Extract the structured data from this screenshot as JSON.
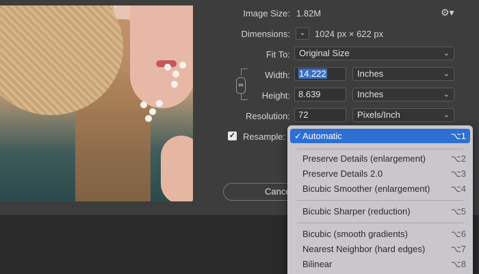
{
  "dialog": {
    "image_size_label": "Image Size:",
    "image_size_value": "1.82M",
    "dimensions_label": "Dimensions:",
    "dimensions_value": "1024 px  ×  622 px",
    "fit_to_label": "Fit To:",
    "fit_to_value": "Original Size",
    "width_label": "Width:",
    "width_value": "14.222",
    "width_unit": "Inches",
    "height_label": "Height:",
    "height_value": "8.639",
    "height_unit": "Inches",
    "resolution_label": "Resolution:",
    "resolution_value": "72",
    "resolution_unit": "Pixels/Inch",
    "resample_label": "Resample:",
    "cancel_label": "Cancel"
  },
  "menu": {
    "items": [
      {
        "label": "Automatic",
        "shortcut": "⌥1",
        "selected": true
      },
      {
        "label": "Preserve Details (enlargement)",
        "shortcut": "⌥2"
      },
      {
        "label": "Preserve Details 2.0",
        "shortcut": "⌥3"
      },
      {
        "label": "Bicubic Smoother (enlargement)",
        "shortcut": "⌥4"
      },
      {
        "label": "Bicubic Sharper (reduction)",
        "shortcut": "⌥5"
      },
      {
        "label": "Bicubic (smooth gradients)",
        "shortcut": "⌥6"
      },
      {
        "label": "Nearest Neighbor (hard edges)",
        "shortcut": "⌥7"
      },
      {
        "label": "Bilinear",
        "shortcut": "⌥8"
      }
    ]
  },
  "icons": {
    "gear": "gear-icon",
    "chain": "chain-link-icon",
    "chevron": "chevron-down-icon",
    "check": "checkmark-icon"
  },
  "colors": {
    "accent": "#2d6fd3",
    "dialog_bg": "#3d3d3d",
    "menu_bg": "#c9c6cc"
  }
}
